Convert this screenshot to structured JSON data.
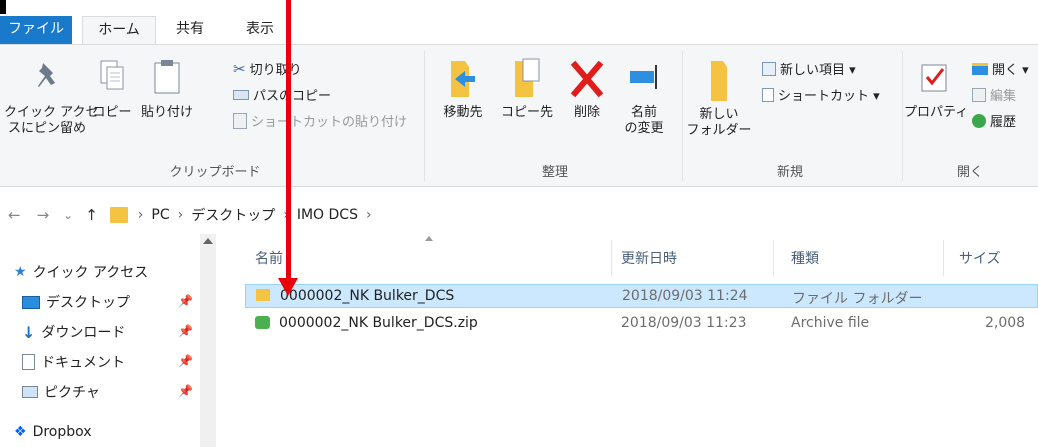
{
  "tabs": {
    "file": "ファイル",
    "home": "ホーム",
    "share": "共有",
    "view": "表示"
  },
  "ribbon": {
    "clipboard": {
      "pin_quick_access_line1": "クイック アクセ",
      "pin_quick_access_line2": "スにピン留め",
      "copy": "コピー",
      "paste": "貼り付け",
      "cut": "切り取り",
      "copy_path": "パスのコピー",
      "paste_shortcut": "ショートカットの貼り付け",
      "group_label": "クリップボード"
    },
    "organize": {
      "move_to": "移動先",
      "copy_to": "コピー先",
      "delete": "削除",
      "rename_line1": "名前",
      "rename_line2": "の変更",
      "group_label": "整理"
    },
    "new": {
      "new_folder_line1": "新しい",
      "new_folder_line2": "フォルダー",
      "new_item": "新しい項目 ▾",
      "shortcut": "ショートカット ▾",
      "group_label": "新規"
    },
    "open": {
      "properties": "プロパティ",
      "open": "開く ▾",
      "edit": "編集",
      "history": "履歴",
      "group_label": "開く"
    }
  },
  "address": {
    "back": "←",
    "forward": "→",
    "recent": "⌄",
    "up": "↑",
    "crumbs": [
      "PC",
      "デスクトップ",
      "IMO DCS"
    ],
    "sep": "›"
  },
  "nav": {
    "items": [
      {
        "label": "クイック アクセス",
        "icon": "star-icon"
      },
      {
        "label": "デスクトップ",
        "icon": "desktop-icon"
      },
      {
        "label": "ダウンロード",
        "icon": "download-icon"
      },
      {
        "label": "ドキュメント",
        "icon": "document-icon"
      },
      {
        "label": "ピクチャ",
        "icon": "picture-icon"
      },
      {
        "label": "Dropbox",
        "icon": "dropbox-icon"
      }
    ],
    "pin_glyph": "📌"
  },
  "list": {
    "columns": {
      "name": "名前",
      "modified": "更新日時",
      "type": "種類",
      "size": "サイズ"
    },
    "rows": [
      {
        "name": "0000002_NK Bulker_DCS",
        "modified": "2018/09/03 11:24",
        "type": "ファイル フォルダー",
        "size": ""
      },
      {
        "name": "0000002_NK Bulker_DCS.zip",
        "modified": "2018/09/03 11:23",
        "type": "Archive file",
        "size": "2,008"
      }
    ]
  },
  "colors": {
    "file_tab": "#1979ca",
    "selection": "#cce8ff",
    "annotation_arrow": "#e8000b"
  }
}
